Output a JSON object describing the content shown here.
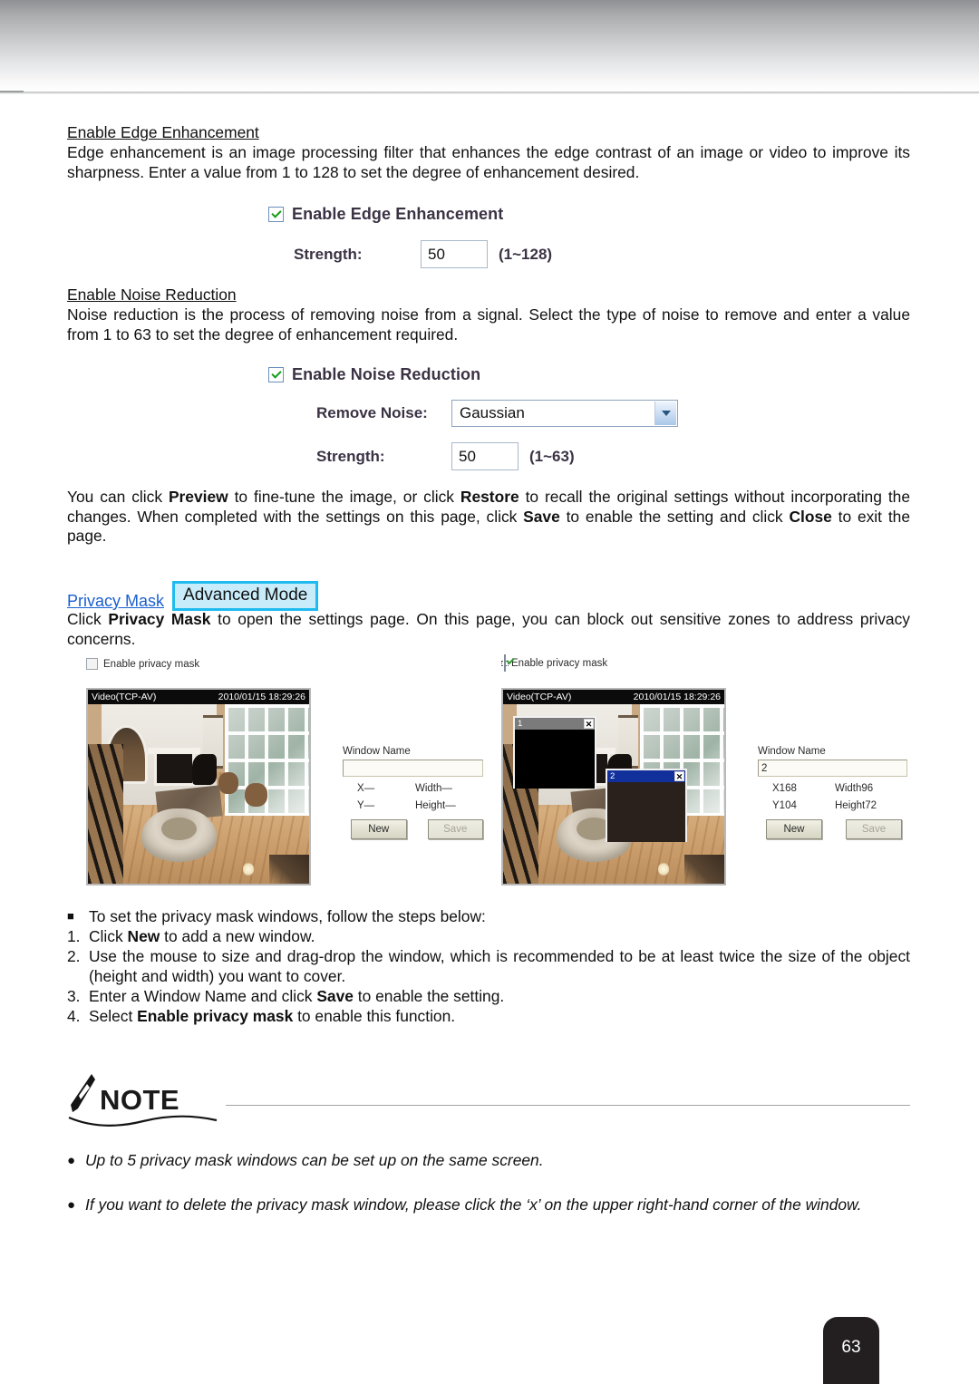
{
  "page": {
    "number": "63"
  },
  "section_edge": {
    "heading": "Enable Edge Enhancement",
    "paragraph": "Edge enhancement is an image processing filter that enhances the edge contrast of an image or video to improve its sharpness. Enter a value from 1 to 128 to set the degree of enhancement desired.",
    "widget": {
      "checkbox_label": "Enable Edge Enhancement",
      "checkbox_checked": true,
      "strength_label": "Strength:",
      "strength_value": "50",
      "strength_hint": "(1~128)"
    }
  },
  "section_noise": {
    "heading": "Enable Noise Reduction",
    "paragraph": "Noise reduction is the process of removing noise from a signal. Select the type of noise to remove and enter a value from 1 to 63 to set the degree of enhancement required.",
    "widget": {
      "checkbox_label": "Enable Noise Reduction",
      "checkbox_checked": true,
      "remove_noise_label": "Remove Noise:",
      "remove_noise_value": "Gaussian",
      "strength_label": "Strength:",
      "strength_value": "50",
      "strength_hint": "(1~63)"
    }
  },
  "preview_paragraph": {
    "p1": "You can click ",
    "b1": "Preview",
    "p2": " to fine-tune the image, or click ",
    "b2": "Restore",
    "p3": " to recall the original settings without incorporating the changes. When completed with the settings on this page, click ",
    "b3": "Save",
    "p4": " to enable the setting and click ",
    "b4": "Close",
    "p5": " to exit the page."
  },
  "privacy_mask": {
    "link_label": "Privacy Mask",
    "badge_label": "Advanced Mode",
    "intro_p1": "Click ",
    "intro_b1": "Privacy Mask",
    "intro_p2": " to open the settings page. On this page, you can block out sensitive zones to address privacy concerns."
  },
  "screenshot_left": {
    "enable_label": "Enable privacy mask",
    "enable_checked": false,
    "video": {
      "stream_label": "Video(TCP-AV)",
      "timestamp": "2010/01/15 18:29:26"
    },
    "form": {
      "window_name_label": "Window Name",
      "window_name_value": "",
      "x_label": "X—",
      "y_label": "Y—",
      "width_label": "Width—",
      "height_label": "Height—",
      "new_button": "New",
      "save_button": "Save"
    },
    "mask_windows": []
  },
  "screenshot_right": {
    "enable_label": "Enable privacy mask",
    "enable_checked": true,
    "video": {
      "stream_label": "Video(TCP-AV)",
      "timestamp": "2010/01/15 18:29:26"
    },
    "form": {
      "window_name_label": "Window Name",
      "window_name_value": "2",
      "x_label": "X168",
      "y_label": "Y104",
      "width_label": "Width96",
      "height_label": "Height72",
      "new_button": "New",
      "save_button": "Save"
    },
    "mask_windows": [
      {
        "title": "1",
        "close": "✕",
        "state": "inactive"
      },
      {
        "title": "2",
        "close": "✕",
        "state": "active"
      }
    ]
  },
  "steps": {
    "intro_marker": "■",
    "intro": "To set the privacy mask windows, follow the steps below:",
    "items": [
      {
        "num": "1.",
        "pre": "Click ",
        "bold": "New",
        "post": " to add a new window."
      },
      {
        "num": "2.",
        "pre": "Use the mouse to size and drag-drop the window, which is recommended to be at least twice the size of the object (height and width) you want to cover.",
        "bold": "",
        "post": ""
      },
      {
        "num": "3.",
        "pre": "Enter a Window Name and click ",
        "bold": "Save",
        "post": " to enable the setting."
      },
      {
        "num": "4.",
        "pre": "Select ",
        "bold": "Enable privacy mask",
        "post": " to enable this function."
      }
    ]
  },
  "note": {
    "title": "NOTE",
    "items": [
      "Up to 5 privacy mask windows can be set up on the same screen.",
      "If you want to delete the privacy mask window, please click the ‘x’ on the upper right-hand corner of the window."
    ]
  }
}
